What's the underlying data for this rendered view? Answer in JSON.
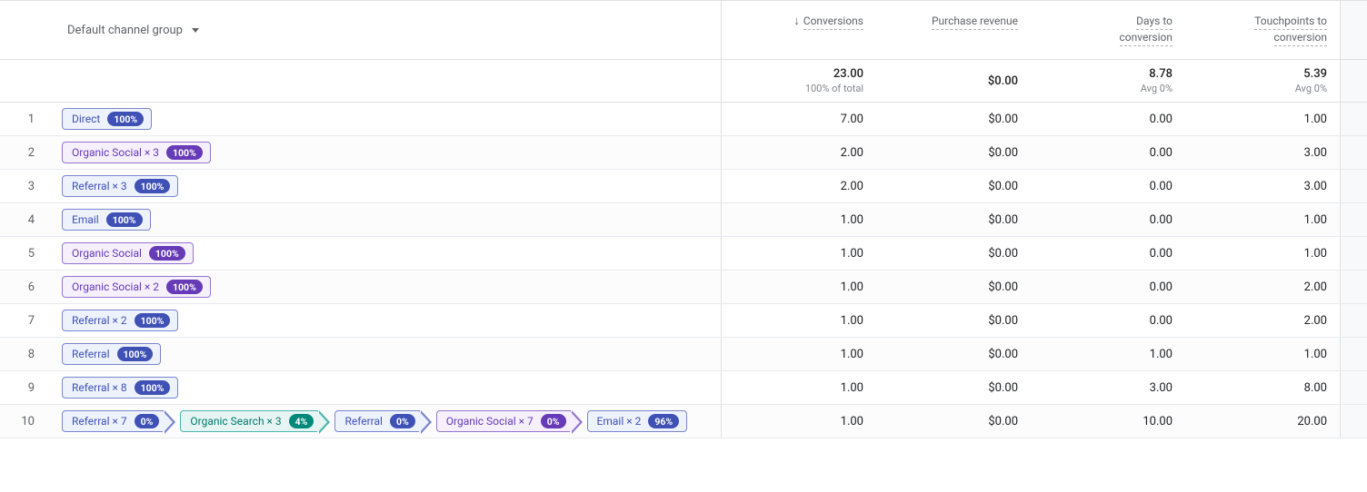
{
  "dimension": {
    "label": "Default channel group"
  },
  "metrics": [
    {
      "label": "Conversions",
      "sorted": true,
      "total": "23.00",
      "sub": "100% of total"
    },
    {
      "label": "Purchase revenue",
      "sorted": false,
      "total": "$0.00",
      "sub": ""
    },
    {
      "label": "Days to conversion",
      "sorted": false,
      "total": "8.78",
      "sub": "Avg 0%"
    },
    {
      "label": "Touchpoints to conversion",
      "sorted": false,
      "total": "5.39",
      "sub": "Avg 0%"
    }
  ],
  "rows": [
    {
      "idx": "1",
      "path": [
        {
          "label": "Direct",
          "pct": "100%",
          "color": "blue"
        }
      ],
      "vals": [
        "7.00",
        "$0.00",
        "0.00",
        "1.00"
      ]
    },
    {
      "idx": "2",
      "path": [
        {
          "label": "Organic Social × 3",
          "pct": "100%",
          "color": "purple"
        }
      ],
      "vals": [
        "2.00",
        "$0.00",
        "0.00",
        "3.00"
      ]
    },
    {
      "idx": "3",
      "path": [
        {
          "label": "Referral × 3",
          "pct": "100%",
          "color": "blue"
        }
      ],
      "vals": [
        "2.00",
        "$0.00",
        "0.00",
        "3.00"
      ]
    },
    {
      "idx": "4",
      "path": [
        {
          "label": "Email",
          "pct": "100%",
          "color": "blue"
        }
      ],
      "vals": [
        "1.00",
        "$0.00",
        "0.00",
        "1.00"
      ]
    },
    {
      "idx": "5",
      "path": [
        {
          "label": "Organic Social",
          "pct": "100%",
          "color": "purple"
        }
      ],
      "vals": [
        "1.00",
        "$0.00",
        "0.00",
        "1.00"
      ]
    },
    {
      "idx": "6",
      "path": [
        {
          "label": "Organic Social × 2",
          "pct": "100%",
          "color": "purple"
        }
      ],
      "vals": [
        "1.00",
        "$0.00",
        "0.00",
        "2.00"
      ]
    },
    {
      "idx": "7",
      "path": [
        {
          "label": "Referral × 2",
          "pct": "100%",
          "color": "blue"
        }
      ],
      "vals": [
        "1.00",
        "$0.00",
        "0.00",
        "2.00"
      ]
    },
    {
      "idx": "8",
      "path": [
        {
          "label": "Referral",
          "pct": "100%",
          "color": "blue"
        }
      ],
      "vals": [
        "1.00",
        "$0.00",
        "1.00",
        "1.00"
      ]
    },
    {
      "idx": "9",
      "path": [
        {
          "label": "Referral × 8",
          "pct": "100%",
          "color": "blue"
        }
      ],
      "vals": [
        "1.00",
        "$0.00",
        "3.00",
        "8.00"
      ]
    },
    {
      "idx": "10",
      "path": [
        {
          "label": "Referral × 7",
          "pct": "0%",
          "color": "blue",
          "arrow": true
        },
        {
          "label": "Organic Search × 3",
          "pct": "4%",
          "color": "teal",
          "arrow": true
        },
        {
          "label": "Referral",
          "pct": "0%",
          "color": "blue",
          "arrow": true
        },
        {
          "label": "Organic Social × 7",
          "pct": "0%",
          "color": "purple",
          "arrow": true
        },
        {
          "label": "Email × 2",
          "pct": "96%",
          "color": "blue"
        }
      ],
      "vals": [
        "1.00",
        "$0.00",
        "10.00",
        "20.00"
      ]
    }
  ]
}
